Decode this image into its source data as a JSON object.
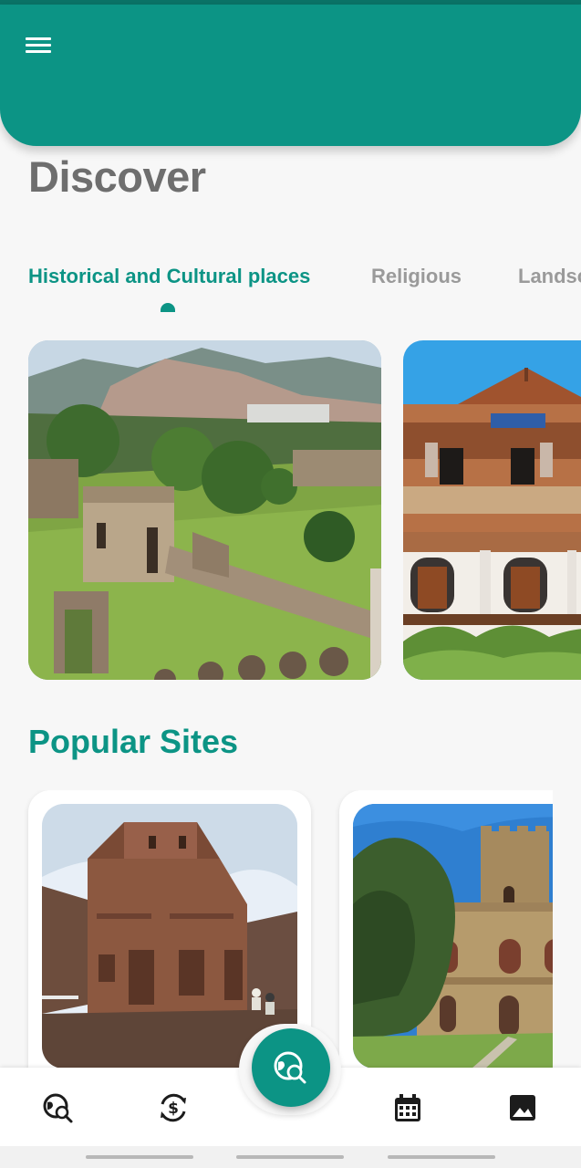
{
  "header": {
    "menu_icon": "hamburger-menu-icon",
    "title": "Discover"
  },
  "categories": {
    "tabs": [
      {
        "label": "Historical and Cultural places",
        "active": true
      },
      {
        "label": "Religious",
        "active": false
      },
      {
        "label": "Landscapes",
        "active": false
      }
    ]
  },
  "featured": [
    {
      "image": "fasil-ghebbi-castle-aerial"
    },
    {
      "image": "harar-ornate-wooden-house"
    }
  ],
  "popular": {
    "title": "Popular Sites",
    "cards": [
      {
        "image": "lalibela-rock-hewn-church"
      },
      {
        "image": "gondar-castle-tower"
      }
    ]
  },
  "bottom_nav": {
    "items": [
      "explore-icon",
      "currency-exchange-icon",
      "explore-fab-icon",
      "calendar-icon",
      "gallery-icon"
    ]
  },
  "colors": {
    "primary": "#0c9485",
    "primary_dark": "#0a7266",
    "title_gray": "#6e6e6e",
    "tab_inactive": "#9a9a9a",
    "background": "#f7f7f7"
  }
}
